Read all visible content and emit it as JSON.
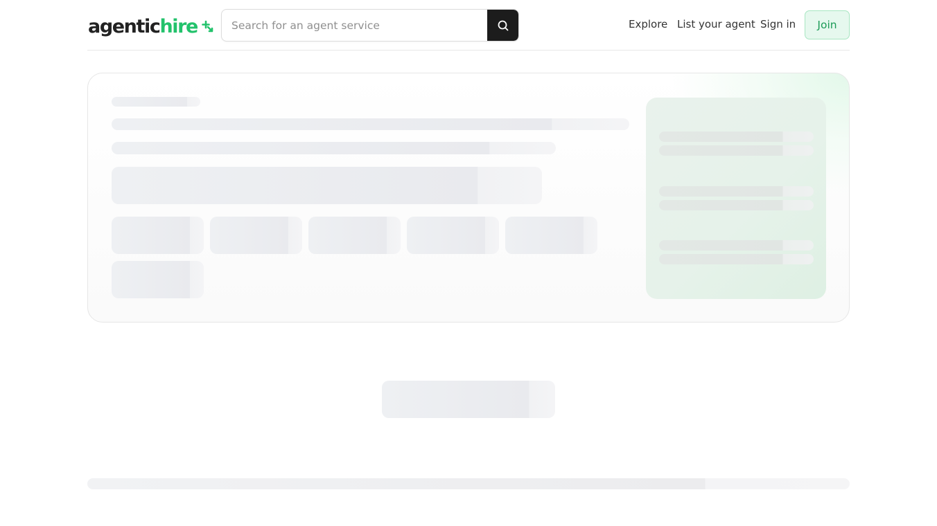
{
  "header": {
    "logo": {
      "part1": "agentic",
      "part2": "hire",
      "mark_icon": "sparkle-plus-icon"
    },
    "search": {
      "placeholder": "Search for an agent service",
      "value": "",
      "button_icon": "search-icon"
    },
    "nav": {
      "explore": "Explore",
      "list_agent": "List your agent",
      "sign_in": "Sign in",
      "join": "Join"
    }
  },
  "colors": {
    "brand_green": "#22c26b",
    "join_bg": "#e6f8ee",
    "join_border": "#a8e6c2",
    "search_button": "#1c1c1c",
    "skeleton": "#eceef1"
  },
  "state": "loading"
}
